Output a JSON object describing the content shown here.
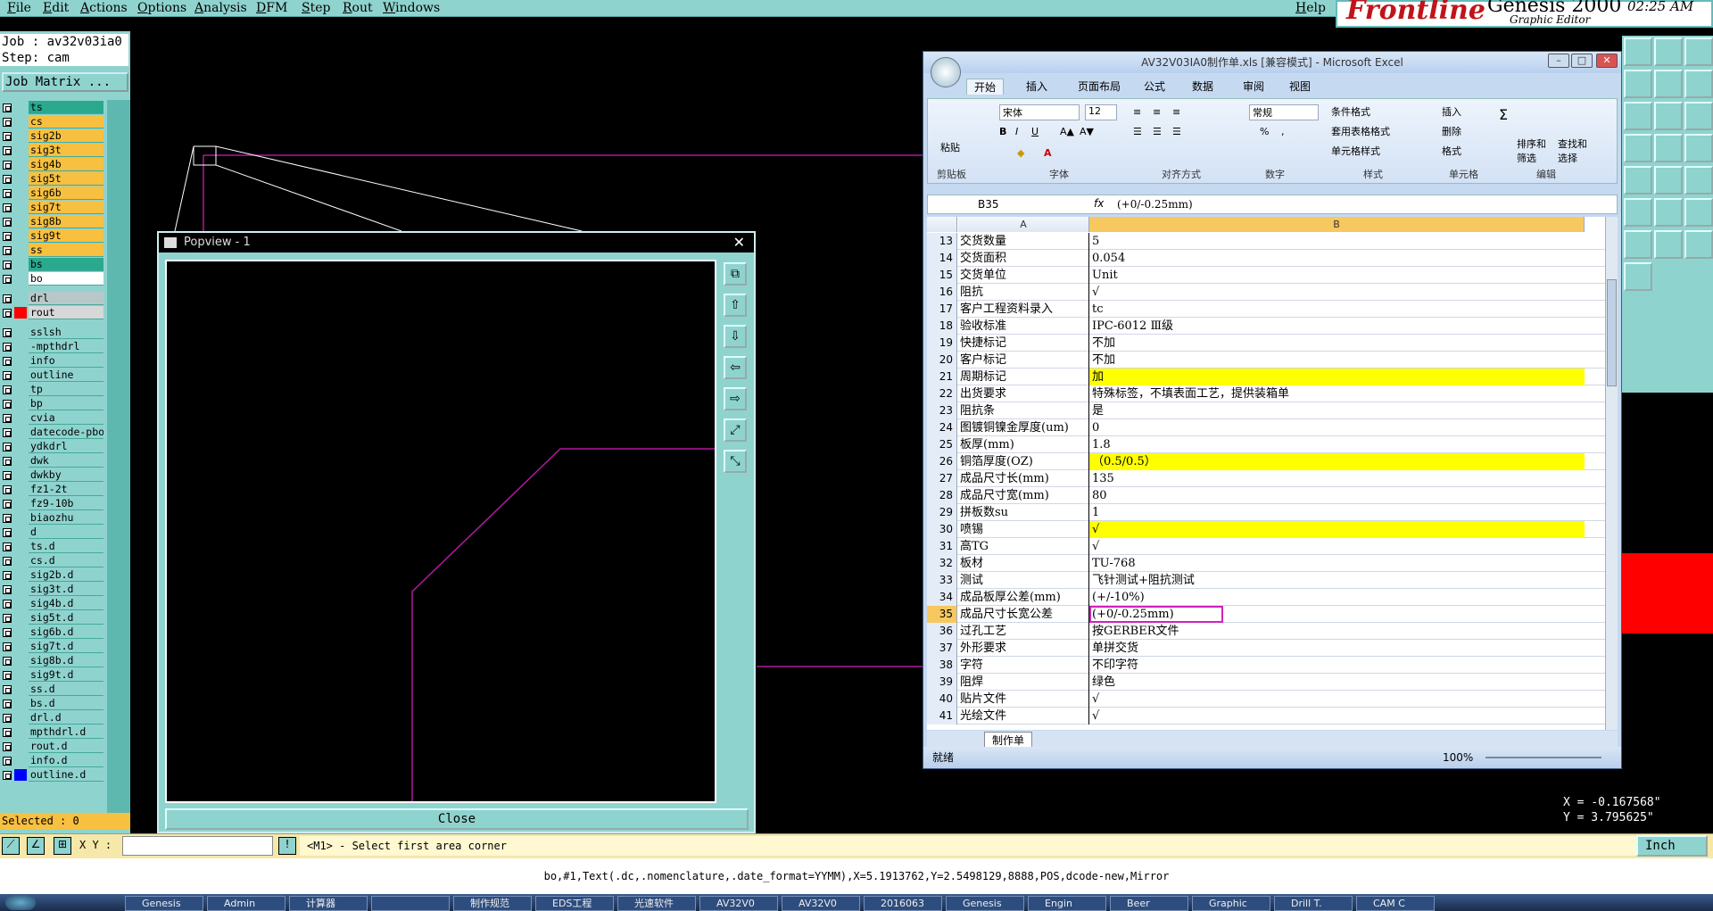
{
  "menu": [
    "File",
    "Edit",
    "Actions",
    "Options",
    "Analysis",
    "DFM",
    "Step",
    "Rout",
    "Windows"
  ],
  "help": "Help",
  "brand": {
    "logo": "Frontline",
    "product": "Genesis 2000",
    "subtitle": "Graphic Editor",
    "clock": "02:25 AM"
  },
  "job": {
    "job_line": "Job : av32v03ia0",
    "step_line": "Step: cam",
    "matrix_button": "Job Matrix ..."
  },
  "layers": [
    {
      "name": "ts",
      "color": "#2aa98f"
    },
    {
      "name": "cs",
      "color": "#f7c040"
    },
    {
      "name": "sig2b",
      "color": "#f7c040"
    },
    {
      "name": "sig3t",
      "color": "#f7c040"
    },
    {
      "name": "sig4b",
      "color": "#f7c040"
    },
    {
      "name": "sig5t",
      "color": "#f7c040"
    },
    {
      "name": "sig6b",
      "color": "#f7c040"
    },
    {
      "name": "sig7t",
      "color": "#f7c040"
    },
    {
      "name": "sig8b",
      "color": "#f7c040"
    },
    {
      "name": "sig9t",
      "color": "#f7c040"
    },
    {
      "name": "ss",
      "color": "#f7c040"
    },
    {
      "name": "bs",
      "color": "#2aa98f"
    },
    {
      "name": "bo",
      "color": "#ffffff"
    },
    {
      "name": "drl",
      "color": "#b8c8c8"
    },
    {
      "name": "rout",
      "color": "#d8d8d8",
      "swatch": "#ff0000",
      "active": true
    },
    {
      "name": "sslsh",
      "color": "#8fd3cf"
    },
    {
      "name": "-mpthdrl",
      "color": "#8fd3cf"
    },
    {
      "name": "info",
      "color": "#8fd3cf"
    },
    {
      "name": "outline",
      "color": "#8fd3cf"
    },
    {
      "name": "tp",
      "color": "#8fd3cf"
    },
    {
      "name": "bp",
      "color": "#8fd3cf"
    },
    {
      "name": "cvia",
      "color": "#8fd3cf"
    },
    {
      "name": "datecode-pbo",
      "color": "#8fd3cf"
    },
    {
      "name": "ydkdrl",
      "color": "#8fd3cf"
    },
    {
      "name": "dwk",
      "color": "#8fd3cf"
    },
    {
      "name": "dwkby",
      "color": "#8fd3cf"
    },
    {
      "name": "fz1-2t",
      "color": "#8fd3cf"
    },
    {
      "name": "fz9-10b",
      "color": "#8fd3cf"
    },
    {
      "name": "biaozhu",
      "color": "#8fd3cf"
    },
    {
      "name": "d",
      "color": "#8fd3cf"
    },
    {
      "name": "ts.d",
      "color": "#8fd3cf"
    },
    {
      "name": "cs.d",
      "color": "#8fd3cf"
    },
    {
      "name": "sig2b.d",
      "color": "#8fd3cf"
    },
    {
      "name": "sig3t.d",
      "color": "#8fd3cf"
    },
    {
      "name": "sig4b.d",
      "color": "#8fd3cf"
    },
    {
      "name": "sig5t.d",
      "color": "#8fd3cf"
    },
    {
      "name": "sig6b.d",
      "color": "#8fd3cf"
    },
    {
      "name": "sig7t.d",
      "color": "#8fd3cf"
    },
    {
      "name": "sig8b.d",
      "color": "#8fd3cf"
    },
    {
      "name": "sig9t.d",
      "color": "#8fd3cf"
    },
    {
      "name": "ss.d",
      "color": "#8fd3cf"
    },
    {
      "name": "bs.d",
      "color": "#8fd3cf"
    },
    {
      "name": "drl.d",
      "color": "#8fd3cf"
    },
    {
      "name": "mpthdrl.d",
      "color": "#8fd3cf"
    },
    {
      "name": "rout.d",
      "color": "#8fd3cf"
    },
    {
      "name": "info.d",
      "color": "#8fd3cf"
    },
    {
      "name": "outline.d",
      "color": "#8fd3cf",
      "swatch": "#0000ff"
    }
  ],
  "selected": "Selected : 0",
  "popview": {
    "title": "Popview - 1",
    "close": "Close"
  },
  "excel": {
    "title": "AV32V03IA0制作单.xls [兼容模式] - Microsoft Excel",
    "tabs": [
      "开始",
      "插入",
      "页面布局",
      "公式",
      "数据",
      "审阅",
      "视图"
    ],
    "font_name": "宋体",
    "font_size": "12",
    "number_format": "常规",
    "groups": [
      "剪贴板",
      "字体",
      "对齐方式",
      "数字",
      "样式",
      "单元格",
      "编辑"
    ],
    "paste": "粘贴",
    "style_buttons": [
      "条件格式",
      "套用表格格式",
      "单元格样式"
    ],
    "cell_buttons": [
      "插入",
      "删除",
      "格式"
    ],
    "edit_buttons": [
      "排序和筛选",
      "查找和选择"
    ],
    "name_box": "B35",
    "formula": "(+0/-0.25mm)",
    "col_a": "A",
    "col_b": "B",
    "rows": [
      {
        "n": "13",
        "a": "交货数量",
        "b": "5"
      },
      {
        "n": "14",
        "a": "交货面积",
        "b": "0.054"
      },
      {
        "n": "15",
        "a": "交货单位",
        "b": "Unit"
      },
      {
        "n": "16",
        "a": "阻抗",
        "b": "√"
      },
      {
        "n": "17",
        "a": "客户工程资料录入",
        "b": "tc"
      },
      {
        "n": "18",
        "a": "验收标准",
        "b": "IPC-6012 Ⅲ级"
      },
      {
        "n": "19",
        "a": "快捷标记",
        "b": "不加"
      },
      {
        "n": "20",
        "a": "客户标记",
        "b": "不加"
      },
      {
        "n": "21",
        "a": "周期标记",
        "b": "加",
        "hl": true
      },
      {
        "n": "22",
        "a": "出货要求",
        "b": "特殊标签，不填表面工艺，提供装箱单"
      },
      {
        "n": "23",
        "a": "阻抗条",
        "b": "是"
      },
      {
        "n": "24",
        "a": "图镀铜镍金厚度(um)",
        "b": "0"
      },
      {
        "n": "25",
        "a": "板厚(mm)",
        "b": "1.8"
      },
      {
        "n": "26",
        "a": "铜箔厚度(OZ)",
        "b": "（0.5/0.5）",
        "hl": true
      },
      {
        "n": "27",
        "a": "成品尺寸长(mm)",
        "b": "135"
      },
      {
        "n": "28",
        "a": "成品尺寸宽(mm)",
        "b": "80"
      },
      {
        "n": "29",
        "a": "拼板数su",
        "b": "1"
      },
      {
        "n": "30",
        "a": "喷锡",
        "b": "√",
        "hl": true
      },
      {
        "n": "31",
        "a": "高TG",
        "b": "√"
      },
      {
        "n": "32",
        "a": "板材",
        "b": "TU-768"
      },
      {
        "n": "33",
        "a": "测试",
        "b": "飞针测试+阻抗测试"
      },
      {
        "n": "34",
        "a": "成品板厚公差(mm)",
        "b": "(+/-10%)"
      },
      {
        "n": "35",
        "a": "成品尺寸长宽公差",
        "b": "(+0/-0.25mm)",
        "sel": true
      },
      {
        "n": "36",
        "a": "过孔工艺",
        "b": "按GERBER文件"
      },
      {
        "n": "37",
        "a": "外形要求",
        "b": "单拼交货"
      },
      {
        "n": "38",
        "a": "字符",
        "b": "不印字符"
      },
      {
        "n": "39",
        "a": "阻焊",
        "b": "绿色"
      },
      {
        "n": "40",
        "a": "贴片文件",
        "b": "√"
      },
      {
        "n": "41",
        "a": "光绘文件",
        "b": "√"
      }
    ],
    "sheet_tab": "制作单",
    "status": "就绪",
    "zoom": "100%"
  },
  "coords": {
    "x": "X = -0.167568\"",
    "y": "Y = 3.795625\""
  },
  "xy_label": "X Y :",
  "prompt": "<M1> - Select first area corner",
  "units": "Inch",
  "status_line": "bo,#1,Text(.dc,.nomenclature,.date_format=YYMM),X=5.1913762,Y=2.5498129,8888,POS,dcode-new,Mirror",
  "taskbar": [
    "Genesis",
    "Admin",
    "计算器",
    "",
    "制作规范",
    "EDS工程",
    "光速软件",
    "AV32V0",
    "AV32V0",
    "2016063",
    "Genesis",
    "Engin",
    "Beer",
    "Graphic",
    "Drill T.",
    "CAM C"
  ],
  "colors": {
    "panel": "#8fd3cf",
    "outline": "#b0189e",
    "accent": "#f7c040"
  }
}
